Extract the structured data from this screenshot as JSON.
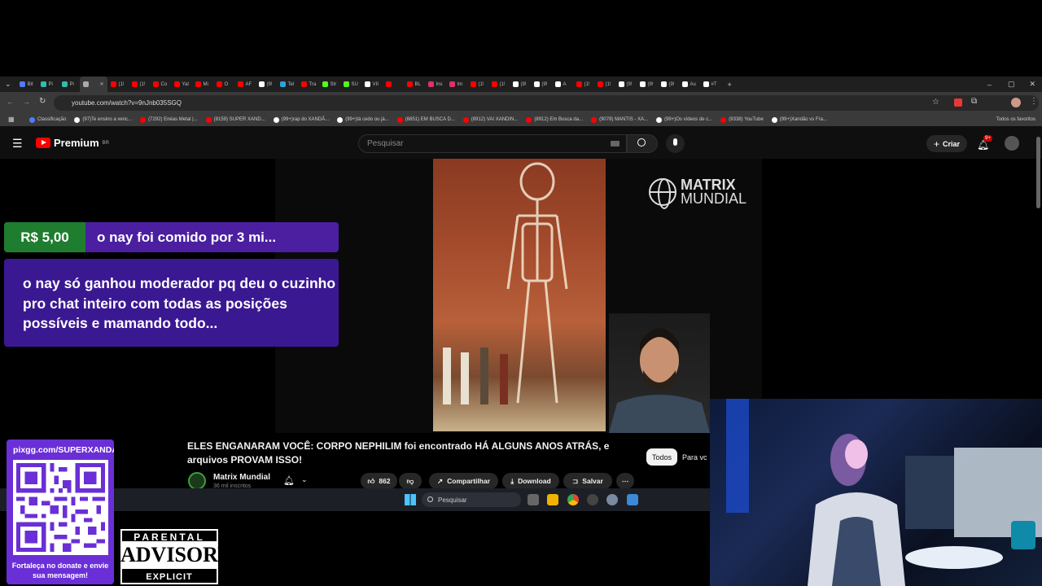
{
  "browser": {
    "tabs": [
      {
        "label": "Bit",
        "color": "#4f7cff"
      },
      {
        "label": "Pi",
        "color": "#32bcad"
      },
      {
        "label": "Pi",
        "color": "#32bcad"
      },
      {
        "label": "",
        "color": "#aaaaaa",
        "active": true
      },
      {
        "label": "(1!",
        "color": "#ff0000"
      },
      {
        "label": "(1!",
        "color": "#ff0000"
      },
      {
        "label": "Co",
        "color": "#ff0000"
      },
      {
        "label": "Yal",
        "color": "#ff0000"
      },
      {
        "label": "Mi",
        "color": "#ff0000"
      },
      {
        "label": "O",
        "color": "#ff0000"
      },
      {
        "label": "AF",
        "color": "#ff0000"
      },
      {
        "label": "(9!",
        "color": "#ffffff"
      },
      {
        "label": "Tel",
        "color": "#2aa3e0"
      },
      {
        "label": "Tra",
        "color": "#ff0000"
      },
      {
        "label": "Str",
        "color": "#53fc18"
      },
      {
        "label": "SU",
        "color": "#53fc18"
      },
      {
        "label": "VII",
        "color": "#ffffff"
      },
      {
        "label": "",
        "color": "#ff0000"
      },
      {
        "label": "BL",
        "color": "#ff0000"
      },
      {
        "label": "Ins",
        "color": "#e1306c"
      },
      {
        "label": "Im",
        "color": "#e1306c"
      },
      {
        "label": "(1!",
        "color": "#ff0000"
      },
      {
        "label": "(1!",
        "color": "#ff0000"
      },
      {
        "label": "(9!",
        "color": "#ffffff"
      },
      {
        "label": "(9!",
        "color": "#ffffff"
      },
      {
        "label": "A",
        "color": "#ffffff"
      },
      {
        "label": "(1!",
        "color": "#ff0000"
      },
      {
        "label": "(1!",
        "color": "#ff0000"
      },
      {
        "label": "(9!",
        "color": "#ffffff"
      },
      {
        "label": "(9!",
        "color": "#ffffff"
      },
      {
        "label": "(9!",
        "color": "#ffffff"
      },
      {
        "label": "Au",
        "color": "#ffffff"
      },
      {
        "label": "#T",
        "color": "#ffffff"
      }
    ],
    "url": "youtube.com/watch?v=9nJnb035SGQ",
    "bookmarks": [
      {
        "label": "Classificação",
        "color": "#4f7cff"
      },
      {
        "label": "(97)Te ensino a venc...",
        "color": "#ffffff"
      },
      {
        "label": "(7292) Enéas Metal |...",
        "color": "#ff0000"
      },
      {
        "label": "(8159) SUPER XAND...",
        "color": "#ff0000"
      },
      {
        "label": "(99+)rap do XANDÃ...",
        "color": "#ffffff"
      },
      {
        "label": "(99+)tá cedo ou já...",
        "color": "#ffffff"
      },
      {
        "label": "(8851) EM BUSCA D...",
        "color": "#ff0000"
      },
      {
        "label": "(8912) VAI XANDIN...",
        "color": "#ff0000"
      },
      {
        "label": "(8912) Em Busca da...",
        "color": "#ff0000"
      },
      {
        "label": "(9078) MANTIS - XA...",
        "color": "#ff0000"
      },
      {
        "label": "(99+)Os vídeos de c...",
        "color": "#ffffff"
      },
      {
        "label": "(9338) YouTube",
        "color": "#ff0000"
      },
      {
        "label": "(99+)Xandão vs Fra...",
        "color": "#ffffff"
      }
    ],
    "all_bookmarks": "Todos os favoritos"
  },
  "youtube": {
    "logo_text": "Premium",
    "logo_region": "BR",
    "search_placeholder": "Pesquisar",
    "create_label": "Criar",
    "notif_count": "9+",
    "channel_watermark_1": "MATRIX",
    "channel_watermark_2": "MUNDIAL",
    "video_title": "ELES ENGANARAM VOCÊ: CORPO NEPHILIM foi encontrado HÁ ALGUNS ANOS ATRÁS, e arquivos PROVAM ISSO!",
    "channel_name": "Matrix Mundial",
    "channel_subs": "36 mil inscritos",
    "likes": "862",
    "share_label": "Compartilhar",
    "download_label": "Download",
    "save_label": "Salvar",
    "chip_all": "Todos",
    "chip_foryou": "Para vc"
  },
  "donation": {
    "amount": "R$ 5,00",
    "header": "o nay foi comido por 3 mi...",
    "message": "o nay só ganhou moderador pq deu o cuzinho pro chat inteiro com todas as posições possíveis e mamando todo..."
  },
  "taskbar": {
    "search_label": "Pesquisar"
  },
  "pix": {
    "url": "pixgg.com/SUPERXANDA",
    "cta": "Fortaleça no donate e envie sua mensagem!"
  },
  "advisory": {
    "line1": "PARENTAL",
    "line2": "ADVISORY",
    "line3": "EXPLICIT CONTENT"
  }
}
